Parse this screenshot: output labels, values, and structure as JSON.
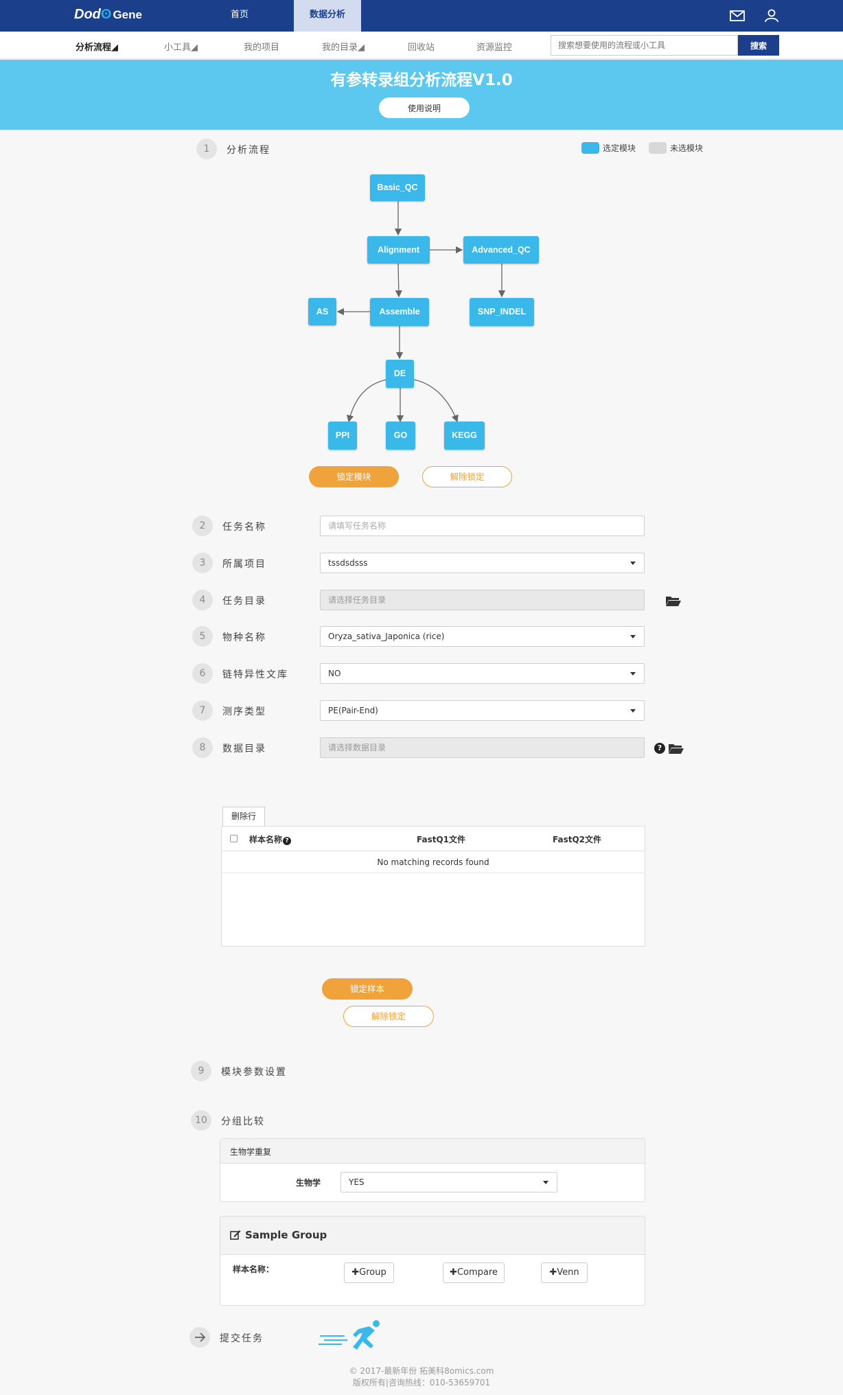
{
  "header": {
    "logo_main": "Dod",
    "logo_o": "ʘ",
    "logo_gene": "Gene",
    "nav": [
      "首页",
      "数据分析"
    ]
  },
  "subnav": {
    "items": [
      "分析流程◢",
      "小工具◢",
      "我的项目",
      "我的目录◢",
      "回收站",
      "资源监控"
    ],
    "search_placeholder": "搜索想要使用的流程或小工具",
    "search_button": "搜索"
  },
  "banner": {
    "title": "有参转录组分析流程V1.0",
    "button": "使用说明"
  },
  "steps": [
    {
      "num": "1",
      "label": "分析流程"
    },
    {
      "num": "2",
      "label": "任务名称"
    },
    {
      "num": "3",
      "label": "所属项目"
    },
    {
      "num": "4",
      "label": "任务目录"
    },
    {
      "num": "5",
      "label": "物种名称"
    },
    {
      "num": "6",
      "label": "链特异性文库"
    },
    {
      "num": "7",
      "label": "测序类型"
    },
    {
      "num": "8",
      "label": "数据目录"
    },
    {
      "num": "9",
      "label": "模块参数设置"
    },
    {
      "num": "10",
      "label": "分组比较"
    }
  ],
  "legend": {
    "selected": "选定模块",
    "unselected": "未选模块",
    "selected_color": "#3ab8ea",
    "unselected_color": "#d8d8d8"
  },
  "diagram": {
    "nodes": [
      "Basic_QC",
      "Alignment",
      "Advanced_QC",
      "AS",
      "Assemble",
      "SNP_INDEL",
      "DE",
      "PPI",
      "GO",
      "KEGG"
    ]
  },
  "module_buttons": {
    "lock": "锁定模块",
    "unlock": "解除锁定"
  },
  "form": {
    "task_name_placeholder": "请填写任务名称",
    "project_value": "tssdsdsss",
    "task_dir_placeholder": "请选择任务目录",
    "species_value": "Oryza_sativa_Japonica (rice)",
    "strand_value": "NO",
    "seq_type_value": "PE(Pair-End)",
    "data_dir_placeholder": "请选择数据目录"
  },
  "table": {
    "delete_row": "删除行",
    "columns": [
      "样本名称",
      "FastQ1文件",
      "FastQ2文件"
    ],
    "empty_text": "No matching records found"
  },
  "sample_buttons": {
    "lock": "锁定样本",
    "unlock": "解除锁定"
  },
  "bio_panel": {
    "title": "生物学重复",
    "label": "生物学",
    "value": "YES"
  },
  "group_panel": {
    "title": "Sample Group",
    "sample_label": "样本名称：",
    "buttons": [
      "Group",
      "Compare",
      "Venn"
    ]
  },
  "submit": {
    "label": "提交任务"
  },
  "footer": {
    "line1": "© 2017-最新年份 拓美科8omics.com",
    "line2": "版权所有|咨询热线：010-53659701"
  },
  "colors": {
    "nav_bg": "#1c3f8c",
    "banner_bg": "#5cc8ef",
    "node": "#3ab8ea",
    "accent_orange": "#f0a23b"
  }
}
